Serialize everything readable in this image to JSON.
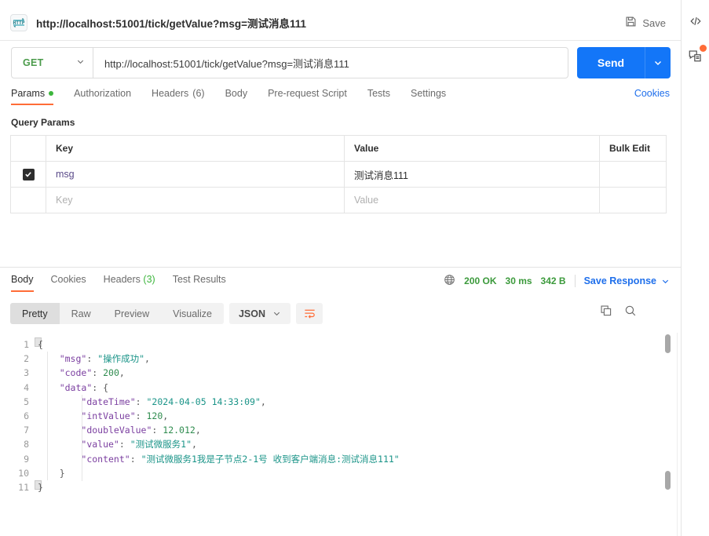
{
  "request": {
    "protocol_icon": "http-icon",
    "title": "http://localhost:51001/tick/getValue?msg=测试消息111",
    "save_label": "Save",
    "method": "GET",
    "url": "http://localhost:51001/tick/getValue?msg=测试消息111",
    "send_label": "Send",
    "tabs": [
      {
        "label": "Params",
        "badge": "dot",
        "active": true
      },
      {
        "label": "Authorization",
        "active": false
      },
      {
        "label": "Headers",
        "count": "(6)",
        "active": false
      },
      {
        "label": "Body",
        "active": false
      },
      {
        "label": "Pre-request Script",
        "active": false
      },
      {
        "label": "Tests",
        "active": false
      },
      {
        "label": "Settings",
        "active": false
      }
    ],
    "cookies_link": "Cookies"
  },
  "query_params": {
    "section_title": "Query Params",
    "columns": [
      "",
      "Key",
      "Value",
      "Bulk Edit"
    ],
    "rows": [
      {
        "checked": true,
        "key": "msg",
        "value": "测试消息111",
        "placeholder": false
      },
      {
        "checked": false,
        "key": "Key",
        "value": "Value",
        "placeholder": true
      }
    ]
  },
  "response": {
    "tabs": [
      {
        "label": "Body",
        "active": true
      },
      {
        "label": "Cookies",
        "active": false
      },
      {
        "label": "Headers",
        "count": "(3)",
        "active": false
      },
      {
        "label": "Test Results",
        "active": false
      }
    ],
    "status": "200 OK",
    "time": "30 ms",
    "size": "342 B",
    "save_response_label": "Save Response",
    "view_modes": [
      {
        "label": "Pretty",
        "active": true
      },
      {
        "label": "Raw",
        "active": false
      },
      {
        "label": "Preview",
        "active": false
      },
      {
        "label": "Visualize",
        "active": false
      }
    ],
    "format": "JSON",
    "actions": [
      "copy-icon",
      "search-icon"
    ]
  },
  "colors": {
    "accent": "#ff6c37",
    "send": "#1376f8",
    "link": "#1f6feb",
    "status_green": "#3c9a3c",
    "method_green": "#4b9b4b",
    "json_key": "#7b3fa0",
    "json_string": "#1a9488",
    "json_number": "#2f8c4f"
  },
  "body_json": {
    "line_numbers": [
      "1",
      "2",
      "3",
      "4",
      "5",
      "6",
      "7",
      "8",
      "9",
      "10",
      "11"
    ],
    "lines": [
      {
        "n": 1,
        "html": "<span class=\"tk-pun\">{</span>"
      },
      {
        "n": 2,
        "html": "    <span class=\"tk-key\">\"msg\"</span><span class=\"tk-pun\">: </span><span class=\"tk-str\">\"操作成功\"</span><span class=\"tk-pun\">,</span>"
      },
      {
        "n": 3,
        "html": "    <span class=\"tk-key\">\"code\"</span><span class=\"tk-pun\">: </span><span class=\"tk-num\">200</span><span class=\"tk-pun\">,</span>"
      },
      {
        "n": 4,
        "html": "    <span class=\"tk-key\">\"data\"</span><span class=\"tk-pun\">: {</span>"
      },
      {
        "n": 5,
        "html": "        <span class=\"tk-key\">\"dateTime\"</span><span class=\"tk-pun\">: </span><span class=\"tk-str\">\"2024-04-05 14:33:09\"</span><span class=\"tk-pun\">,</span>"
      },
      {
        "n": 6,
        "html": "        <span class=\"tk-key\">\"intValue\"</span><span class=\"tk-pun\">: </span><span class=\"tk-num\">120</span><span class=\"tk-pun\">,</span>"
      },
      {
        "n": 7,
        "html": "        <span class=\"tk-key\">\"doubleValue\"</span><span class=\"tk-pun\">: </span><span class=\"tk-num\">12.012</span><span class=\"tk-pun\">,</span>"
      },
      {
        "n": 8,
        "html": "        <span class=\"tk-key\">\"value\"</span><span class=\"tk-pun\">: </span><span class=\"tk-str\">\"测试微服务1\"</span><span class=\"tk-pun\">,</span>"
      },
      {
        "n": 9,
        "html": "        <span class=\"tk-key\">\"content\"</span><span class=\"tk-pun\">: </span><span class=\"tk-str\">\"测试微服务1我是子节点2-1号 收到客户端消息:测试消息111\"</span>"
      },
      {
        "n": 10,
        "html": "    <span class=\"tk-pun\">}</span>"
      },
      {
        "n": 11,
        "html": "<span class=\"tk-pun\">}</span>"
      }
    ],
    "raw": {
      "msg": "操作成功",
      "code": 200,
      "data": {
        "dateTime": "2024-04-05 14:33:09",
        "intValue": 120,
        "doubleValue": 12.012,
        "value": "测试微服务1",
        "content": "测试微服务1我是子节点2-1号 收到客户端消息:测试消息111"
      }
    }
  },
  "rail": {
    "items": [
      {
        "icon": "code-snippet-icon",
        "badge": false
      },
      {
        "icon": "comments-icon",
        "badge": true
      }
    ]
  }
}
